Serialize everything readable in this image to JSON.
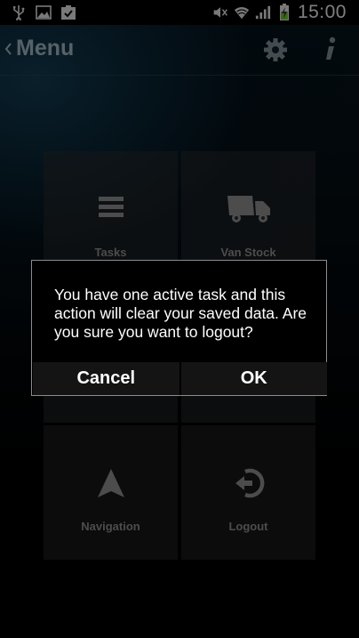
{
  "status_bar": {
    "time": "15:00",
    "left_icons": [
      "usb-icon",
      "image-icon",
      "clipboard-check-icon"
    ],
    "right_icons": [
      "mute-icon",
      "wifi-icon",
      "signal-icon",
      "battery-charging-icon"
    ]
  },
  "action_bar": {
    "title": "Menu",
    "buttons": [
      "settings-gear-icon",
      "info-icon"
    ]
  },
  "tiles": [
    {
      "label": "Tasks",
      "icon": "list-icon"
    },
    {
      "label": "Van Stock",
      "icon": "truck-icon"
    },
    {
      "label": "",
      "icon": ""
    },
    {
      "label": "",
      "icon": ""
    },
    {
      "label": "Navigation",
      "icon": "navigation-arrow-icon"
    },
    {
      "label": "Logout",
      "icon": "logout-icon"
    }
  ],
  "dialog": {
    "message": "You have one active task and this action will clear your saved data. Are you sure you want to logout?",
    "cancel_label": "Cancel",
    "ok_label": "OK"
  },
  "colors": {
    "title": "#9db2bd",
    "tile_label": "#8a8a8a",
    "tile_bg": "#28292b",
    "battery_green": "#6bbf2a"
  }
}
